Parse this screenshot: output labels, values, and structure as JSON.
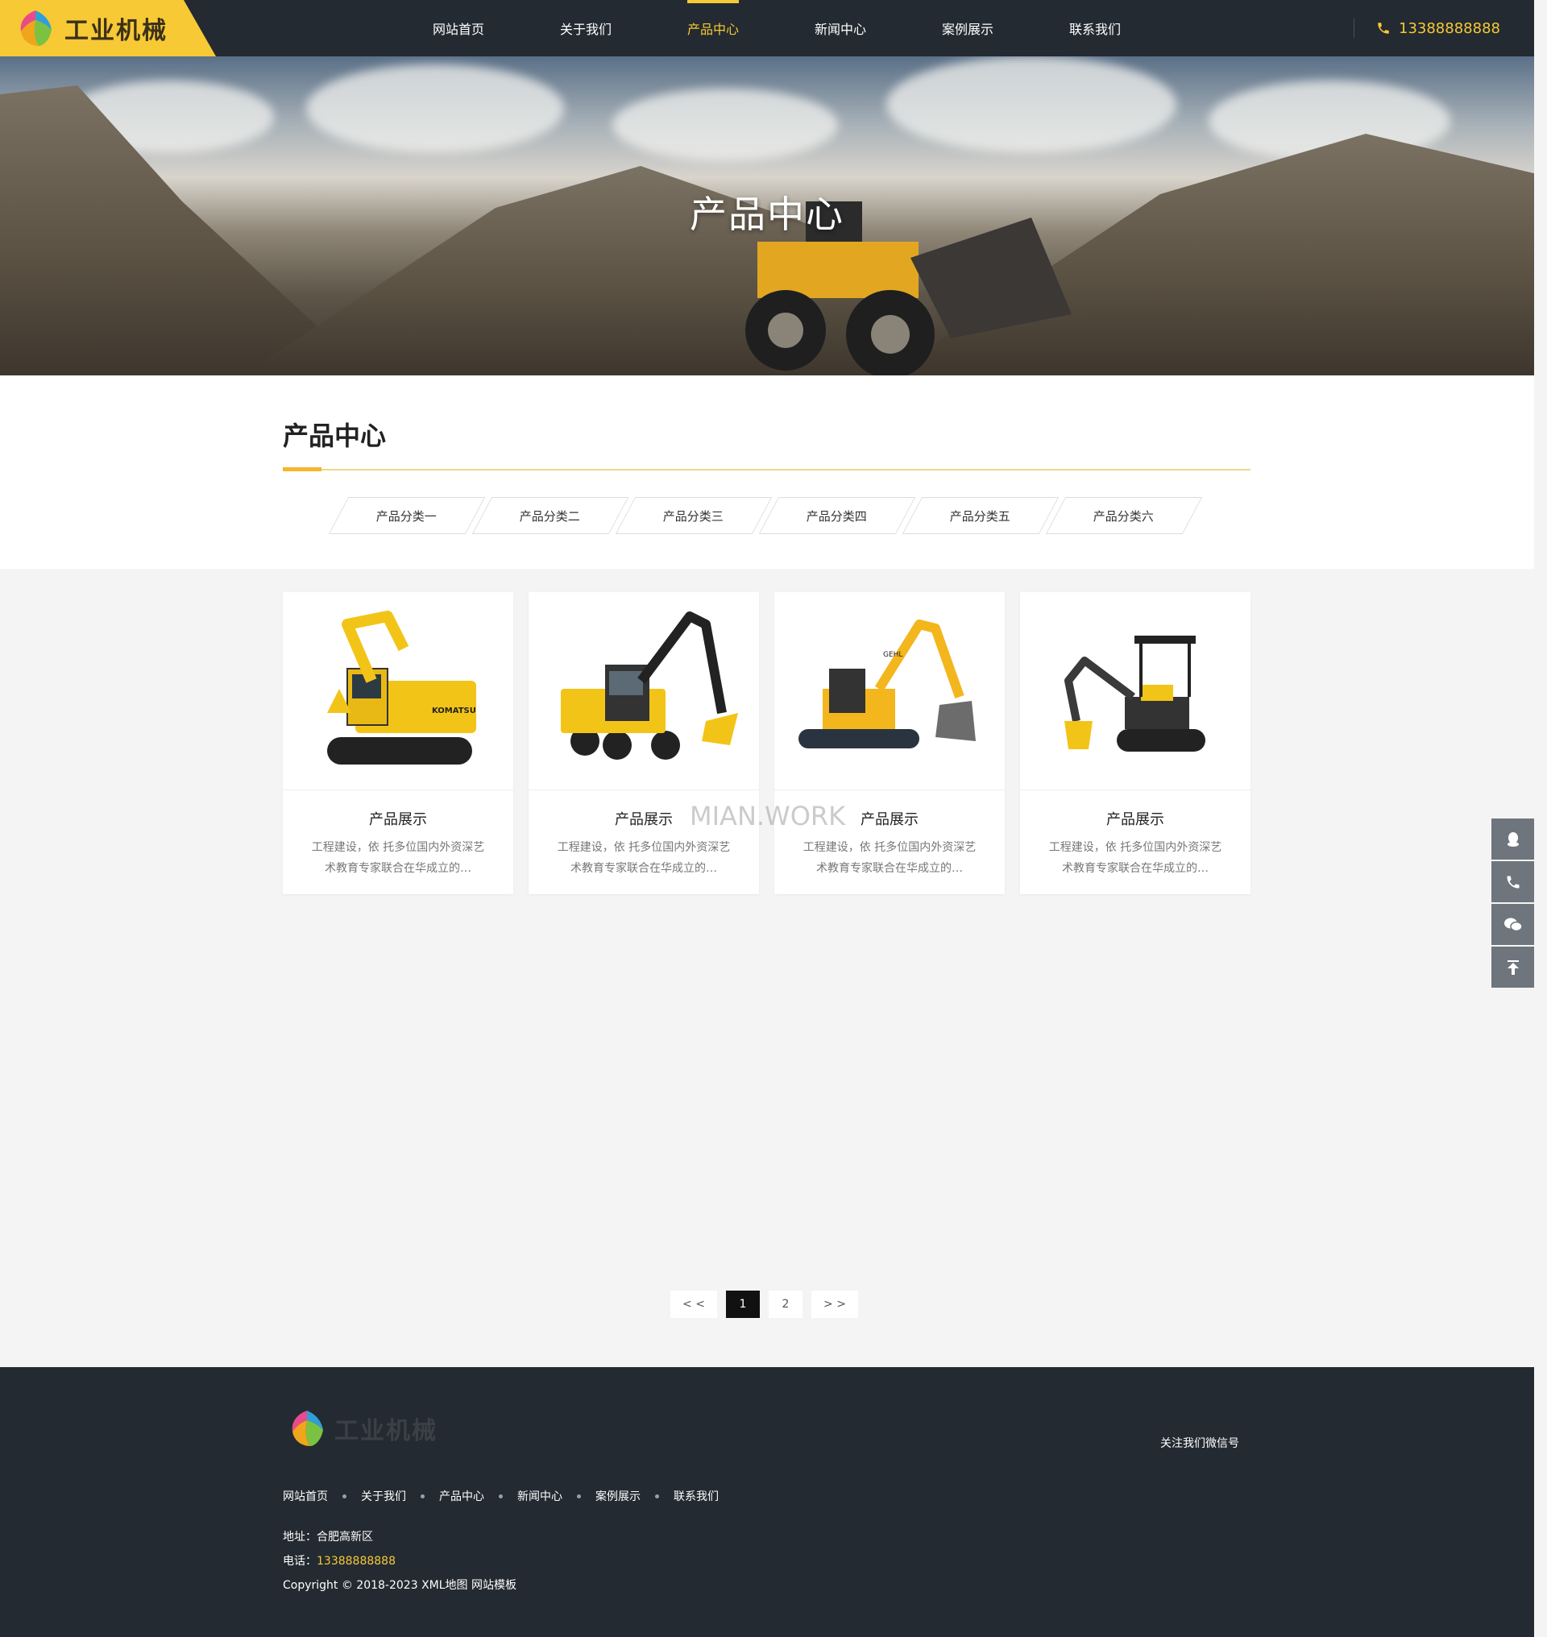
{
  "header": {
    "logo_text": "工业机械",
    "nav": [
      {
        "label": "网站首页",
        "active": false
      },
      {
        "label": "关于我们",
        "active": false
      },
      {
        "label": "产品中心",
        "active": true
      },
      {
        "label": "新闻中心",
        "active": false
      },
      {
        "label": "案例展示",
        "active": false
      },
      {
        "label": "联系我们",
        "active": false
      }
    ],
    "phone": "13388888888"
  },
  "banner": {
    "title": "产品中心"
  },
  "section": {
    "title": "产品中心",
    "categories": [
      "产品分类一",
      "产品分类二",
      "产品分类三",
      "产品分类四",
      "产品分类五",
      "产品分类六"
    ]
  },
  "products": [
    {
      "title": "产品展示",
      "desc": "工程建设，依 托多位国内外资深艺术教育专家联合在华成立的…",
      "image": "yellow-crawler-excavator"
    },
    {
      "title": "产品展示",
      "desc": "工程建设，依 托多位国内外资深艺术教育专家联合在华成立的…",
      "image": "wheeled-excavator"
    },
    {
      "title": "产品展示",
      "desc": "工程建设，依 托多位国内外资深艺术教育专家联合在华成立的…",
      "image": "compact-excavator"
    },
    {
      "title": "产品展示",
      "desc": "工程建设，依 托多位国内外资深艺术教育专家联合在华成立的…",
      "image": "mini-excavator"
    }
  ],
  "watermark": "MIAN.WORK",
  "pagination": {
    "prev": "< <",
    "pages": [
      "1",
      "2"
    ],
    "current": "1",
    "next": "> >"
  },
  "side_tools": [
    "qq-icon",
    "phone-icon",
    "wechat-icon",
    "back-to-top-icon"
  ],
  "footer": {
    "logo_text": "工业机械",
    "follow_text": "关注我们微信号",
    "nav": [
      "网站首页",
      "关于我们",
      "产品中心",
      "新闻中心",
      "案例展示",
      "联系我们"
    ],
    "address_label": "地址：",
    "address": "合肥高新区",
    "phone_label": "电话：",
    "phone": "13388888888",
    "copyright": "Copyright © 2018-2023 XML地图 网站模板"
  },
  "colors": {
    "accent": "#f7c935",
    "header_bg": "#232a31",
    "footer_bg": "#232a31",
    "page_bg": "#f4f4f4"
  }
}
